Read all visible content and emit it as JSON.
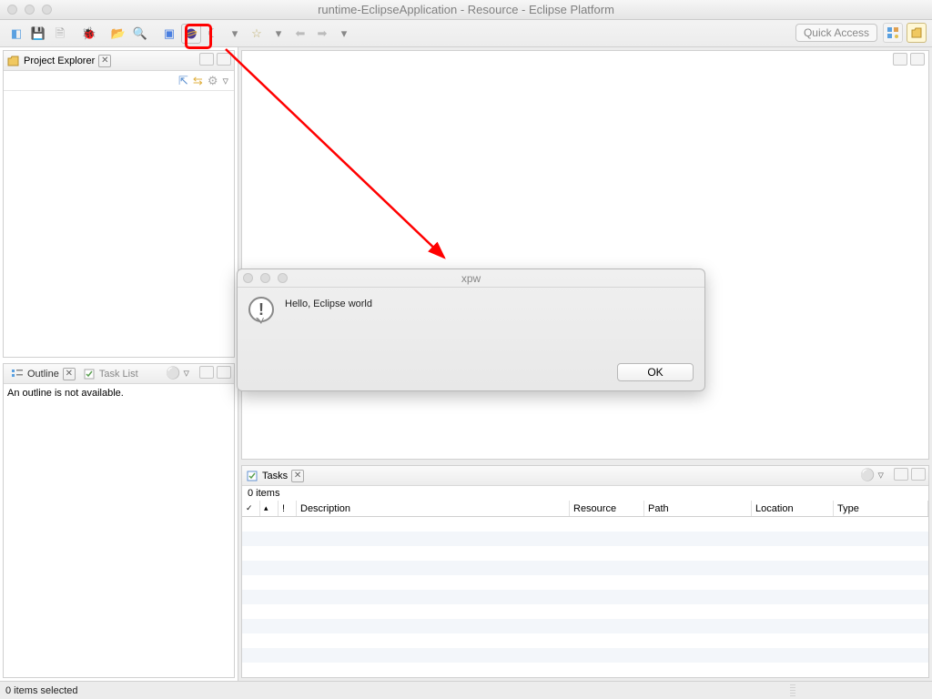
{
  "window": {
    "title": "runtime-EclipseApplication - Resource - Eclipse Platform"
  },
  "toolbar": {
    "quick_access": "Quick Access"
  },
  "projectExplorer": {
    "title": "Project Explorer"
  },
  "outline": {
    "tab1": "Outline",
    "tab2": "Task List",
    "body": "An outline is not available."
  },
  "tasks": {
    "title": "Tasks",
    "count": "0 items",
    "cols": {
      "complete": "",
      "priority": "!",
      "desc": "Description",
      "resource": "Resource",
      "path": "Path",
      "location": "Location",
      "type": "Type"
    }
  },
  "dialog": {
    "title": "xpw",
    "message": "Hello, Eclipse world",
    "ok": "OK"
  },
  "status": {
    "text": "0 items selected"
  }
}
